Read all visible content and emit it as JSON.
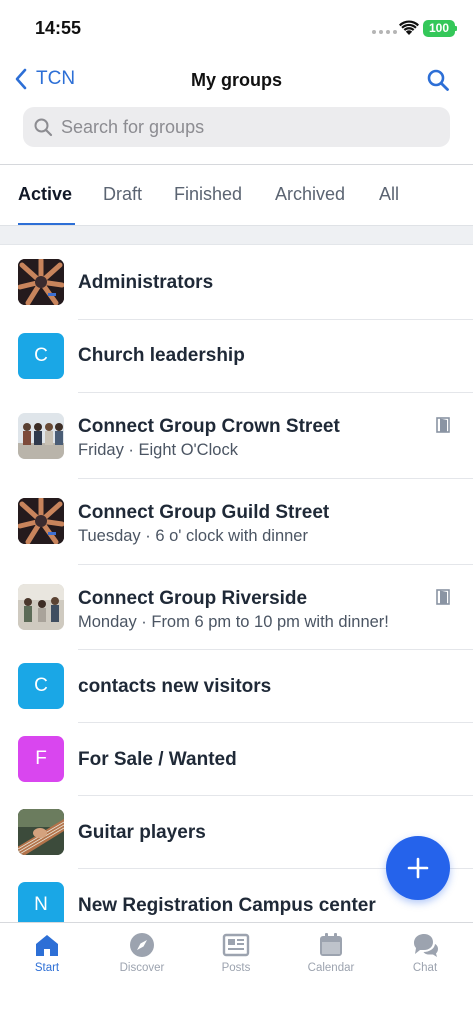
{
  "status_bar": {
    "time": "14:55",
    "battery": "100"
  },
  "nav": {
    "back_label": "TCN",
    "title": "My groups"
  },
  "search": {
    "placeholder": "Search for groups"
  },
  "tabs": [
    {
      "label": "Active",
      "active": true
    },
    {
      "label": "Draft"
    },
    {
      "label": "Finished"
    },
    {
      "label": "Archived"
    },
    {
      "label": "All"
    }
  ],
  "groups": [
    {
      "title": "Administrators",
      "subtitle": "",
      "avatar": "photo-hands"
    },
    {
      "title": "Church leadership",
      "subtitle": "",
      "avatar_letter": "C",
      "avatar_color": "#1aa7e6"
    },
    {
      "title": "Connect Group Crown Street",
      "subtitle": "Friday · Eight O'Clock",
      "avatar": "photo-people",
      "icon": "door-icon"
    },
    {
      "title": "Connect Group Guild Street",
      "subtitle": "Tuesday · 6 o' clock with dinner",
      "avatar": "photo-hands"
    },
    {
      "title": "Connect Group Riverside",
      "subtitle": "Monday · From 6 pm to 10 pm with dinner!",
      "avatar": "photo-people",
      "icon": "door-icon"
    },
    {
      "title": "contacts new visitors",
      "subtitle": "",
      "avatar_letter": "C",
      "avatar_color": "#1aa7e6"
    },
    {
      "title": "For Sale / Wanted",
      "subtitle": "",
      "avatar_letter": "F",
      "avatar_color": "#d946ef"
    },
    {
      "title": "Guitar players",
      "subtitle": "",
      "avatar": "photo-guitar"
    },
    {
      "title": "New Registration Campus center",
      "subtitle": "",
      "avatar_letter": "N",
      "avatar_color": "#1aa7e6"
    }
  ],
  "tab_bar": [
    {
      "label": "Start",
      "icon": "home-icon",
      "active": true
    },
    {
      "label": "Discover",
      "icon": "compass-icon"
    },
    {
      "label": "Posts",
      "icon": "newspaper-icon"
    },
    {
      "label": "Calendar",
      "icon": "calendar-icon"
    },
    {
      "label": "Chat",
      "icon": "chat-icon"
    }
  ],
  "colors": {
    "accent": "#2d6fd6",
    "fab": "#2563eb",
    "avatar_blue": "#1aa7e6",
    "avatar_magenta": "#d946ef"
  }
}
